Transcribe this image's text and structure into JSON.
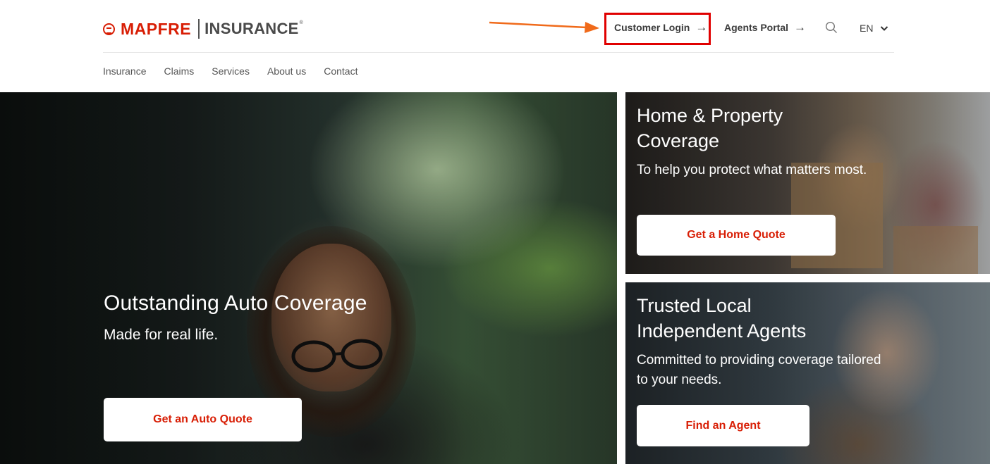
{
  "header": {
    "logo": {
      "brand": "MAPFRE",
      "product": "INSURANCE",
      "registered": "®"
    },
    "customer_login": "Customer Login",
    "agents_portal": "Agents Portal",
    "arrow_glyph": "→",
    "language": "EN",
    "icons": {
      "search": "search-icon",
      "chevron": "chevron-down-icon",
      "login_arrow": "arrow-right-icon"
    }
  },
  "nav": {
    "items": [
      {
        "label": "Insurance"
      },
      {
        "label": "Claims"
      },
      {
        "label": "Services"
      },
      {
        "label": "About us"
      },
      {
        "label": "Contact"
      }
    ]
  },
  "hero": {
    "title": "Outstanding Auto Coverage",
    "subtitle": "Made for real life.",
    "cta": "Get an Auto Quote"
  },
  "cards": [
    {
      "title": "Home & Property Coverage",
      "subtitle": "To help you protect what matters most.",
      "cta": "Get a Home Quote"
    },
    {
      "title": "Trusted Local Independent Agents",
      "subtitle": "Committed to providing coverage tailored to your needs.",
      "cta": "Find an Agent"
    }
  ],
  "colors": {
    "brand_red": "#d81e05",
    "highlight_box": "#e00000",
    "annotation_arrow": "#f06a1a"
  }
}
